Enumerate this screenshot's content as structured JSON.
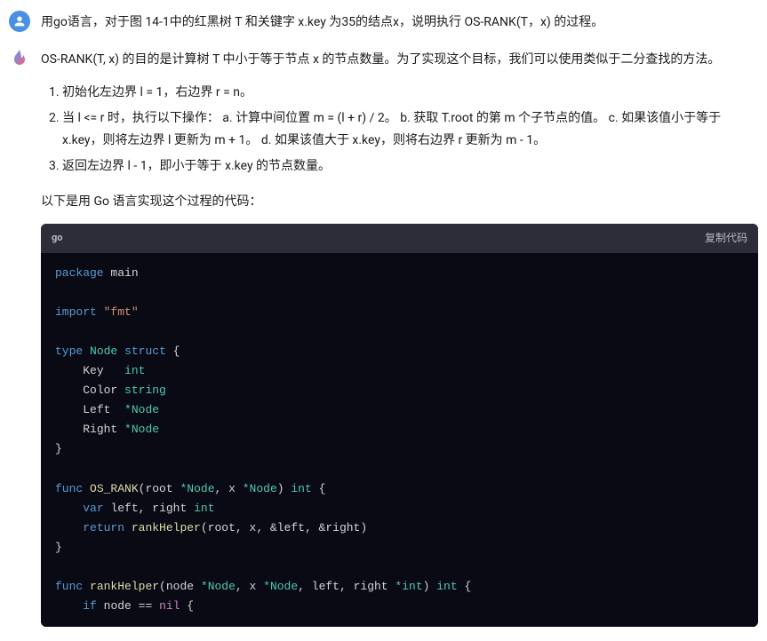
{
  "user_message": "用go语言，对于图 14-1中的红黑树 T 和关键字 x.key 为35的结点x，说明执行 OS-RANK(T，x) 的过程。",
  "bot": {
    "intro": "OS-RANK(T, x) 的目的是计算树 T 中小于等于节点 x 的节点数量。为了实现这个目标，我们可以使用类似于二分查找的方法。",
    "list": {
      "item1": "初始化左边界 l = 1，右边界 r = n。",
      "item2": "当 l <= r 时，执行以下操作： a. 计算中间位置 m = (l + r) / 2。 b. 获取 T.root 的第 m 个子节点的值。 c. 如果该值小于等于 x.key，则将左边界 l 更新为 m + 1。 d. 如果该值大于 x.key，则将右边界 r 更新为 m - 1。",
      "item3": "返回左边界 l - 1，即小于等于 x.key 的节点数量。"
    },
    "outro": "以下是用 Go 语言实现这个过程的代码："
  },
  "code": {
    "lang": "go",
    "copy_label": "复制代码",
    "tokens": {
      "package": "package",
      "main": "main",
      "import": "import",
      "fmt": "\"fmt\"",
      "type": "type",
      "Node": "Node",
      "struct": "struct",
      "Key": "Key",
      "int": "int",
      "Color": "Color",
      "string": "string",
      "Left": "Left",
      "NodePtr": "*Node",
      "Right": "Right",
      "func": "func",
      "OS_RANK": "OS_RANK",
      "root": "root",
      "x": "x",
      "var": "var",
      "left": "left",
      "right": "right",
      "return": "return",
      "rankHelper": "rankHelper",
      "amp_left": "&left",
      "amp_right": "&right",
      "node": "node",
      "intPtr": "*int",
      "if": "if",
      "nil": "nil",
      "eqeq": "=="
    }
  }
}
